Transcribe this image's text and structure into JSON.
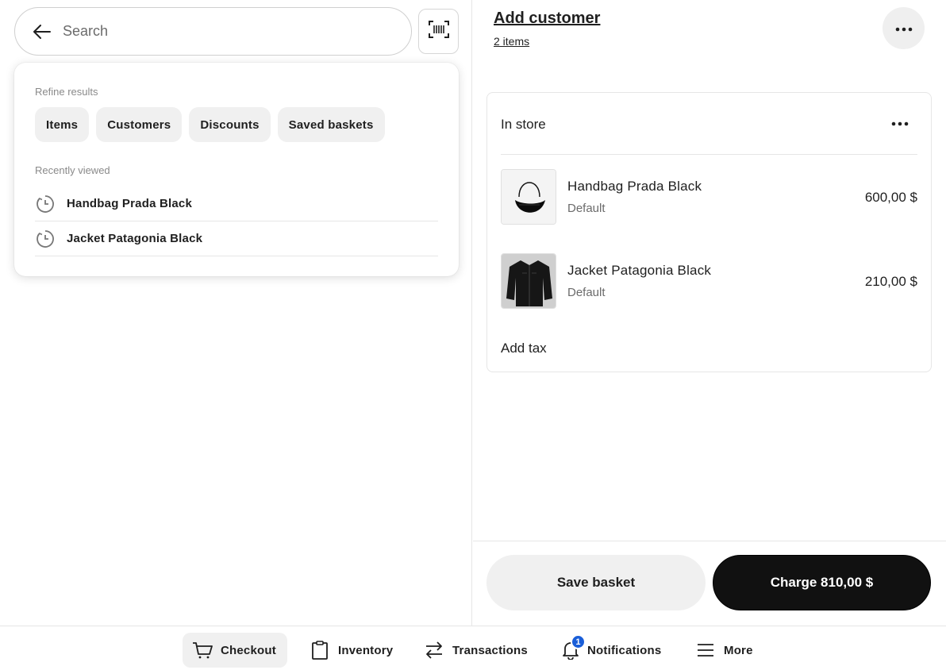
{
  "search": {
    "placeholder": "Search"
  },
  "dropdown": {
    "refine_label": "Refine results",
    "chips": [
      "Items",
      "Customers",
      "Discounts",
      "Saved baskets"
    ],
    "recent_label": "Recently viewed",
    "recent_items": [
      "Handbag Prada Black",
      "Jacket Patagonia Black"
    ]
  },
  "cart": {
    "add_customer": "Add customer",
    "items_count": "2 items",
    "location": "In store",
    "line_items": [
      {
        "name": "Handbag Prada Black",
        "variant": "Default",
        "price": "600,00 $"
      },
      {
        "name": "Jacket Patagonia Black",
        "variant": "Default",
        "price": "210,00 $"
      }
    ],
    "add_tax": "Add tax",
    "save_basket": "Save basket",
    "charge": "Charge 810,00 $"
  },
  "nav": {
    "items": [
      {
        "label": "Checkout",
        "icon": "cart-icon",
        "active": true
      },
      {
        "label": "Inventory",
        "icon": "clipboard-icon"
      },
      {
        "label": "Transactions",
        "icon": "transfer-arrows-icon"
      },
      {
        "label": "Notifications",
        "icon": "bell-icon",
        "badge": "1"
      },
      {
        "label": "More",
        "icon": "menu-icon"
      }
    ]
  },
  "colors": {
    "accent": "#1a5ed8",
    "charge_bg": "#111111",
    "chip_bg": "#f0f0f0"
  }
}
